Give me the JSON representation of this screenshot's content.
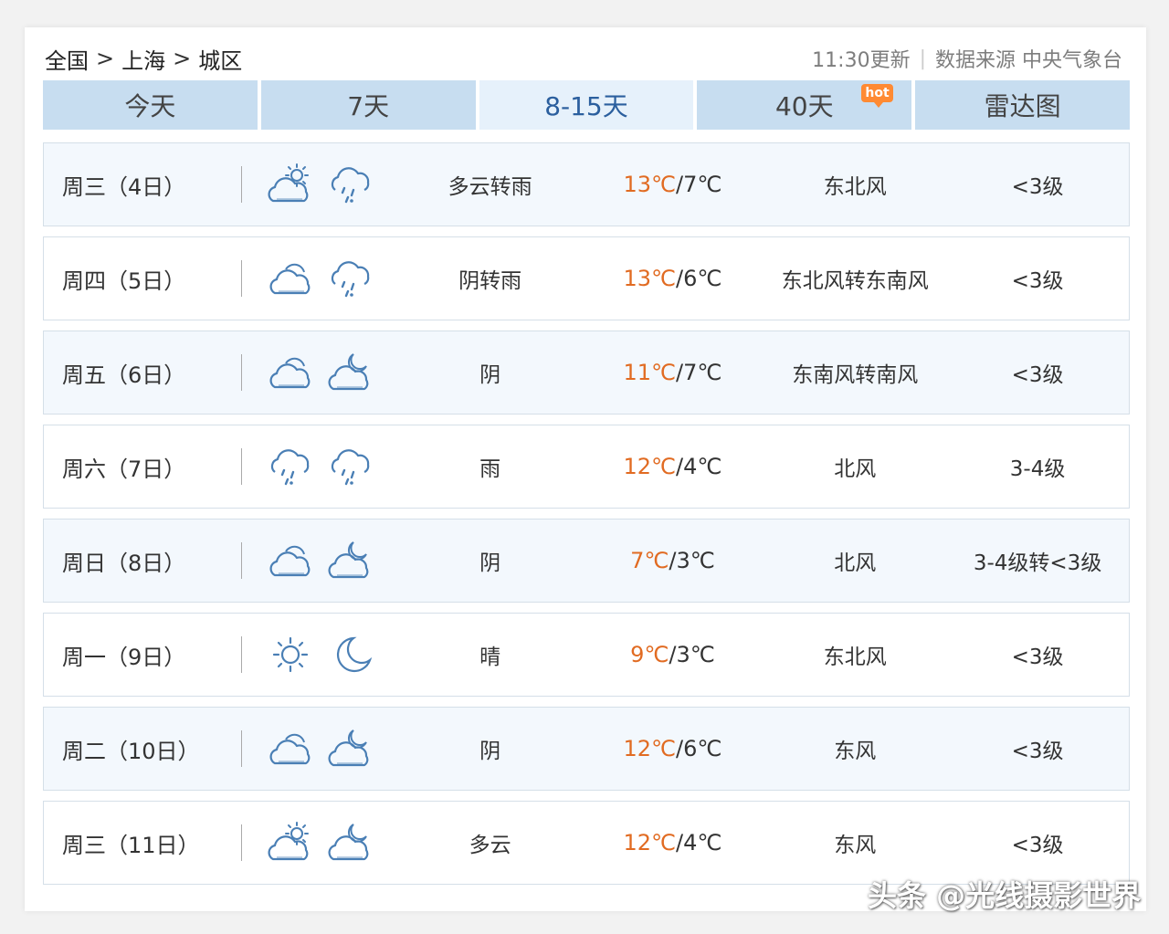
{
  "breadcrumb": {
    "items": [
      "全国",
      "上海",
      "城区"
    ],
    "separator": ">"
  },
  "meta": {
    "updated": "11:30更新",
    "source": "数据来源 中央气象台"
  },
  "tabs": [
    {
      "label": "今天"
    },
    {
      "label": "7天"
    },
    {
      "label": "8-15天",
      "active": true
    },
    {
      "label": "40天",
      "badge": "hot"
    },
    {
      "label": "雷达图"
    }
  ],
  "forecast": [
    {
      "day": "周三（4日）",
      "icons": [
        "partly-cloudy-day-icon",
        "rain-icon"
      ],
      "weather": "多云转雨",
      "high": "13℃",
      "low": "7℃",
      "wind": "东北风",
      "level": "<3级"
    },
    {
      "day": "周四（5日）",
      "icons": [
        "cloudy-icon",
        "rain-icon"
      ],
      "weather": "阴转雨",
      "high": "13℃",
      "low": "6℃",
      "wind": "东北风转东南风",
      "level": "<3级"
    },
    {
      "day": "周五（6日）",
      "icons": [
        "cloudy-icon",
        "partly-cloudy-night-icon"
      ],
      "weather": "阴",
      "high": "11℃",
      "low": "7℃",
      "wind": "东南风转南风",
      "level": "<3级"
    },
    {
      "day": "周六（7日）",
      "icons": [
        "rain-icon",
        "rain-icon"
      ],
      "weather": "雨",
      "high": "12℃",
      "low": "4℃",
      "wind": "北风",
      "level": "3-4级"
    },
    {
      "day": "周日（8日）",
      "icons": [
        "cloudy-icon",
        "partly-cloudy-night-icon"
      ],
      "weather": "阴",
      "high": "7℃",
      "low": "3℃",
      "wind": "北风",
      "level": "3-4级转<3级"
    },
    {
      "day": "周一（9日）",
      "icons": [
        "sun-icon",
        "moon-icon"
      ],
      "weather": "晴",
      "high": "9℃",
      "low": "3℃",
      "wind": "东北风",
      "level": "<3级"
    },
    {
      "day": "周二（10日）",
      "icons": [
        "cloudy-icon",
        "partly-cloudy-night-icon"
      ],
      "weather": "阴",
      "high": "12℃",
      "low": "6℃",
      "wind": "东风",
      "level": "<3级"
    },
    {
      "day": "周三（11日）",
      "icons": [
        "partly-cloudy-day-icon",
        "partly-cloudy-night-icon"
      ],
      "weather": "多云",
      "high": "12℃",
      "low": "4℃",
      "wind": "东风",
      "level": "<3级"
    }
  ],
  "watermark": "头条 @光线摄影世界",
  "colors": {
    "tab": "#c7ddf0",
    "tab_active": "#e6f1fb",
    "accent": "#2b5f9e",
    "high_temp": "#e16b22",
    "row_alt": "#f3f8fd",
    "icon": "#4a7fb5",
    "hot_badge": "#ff8a33"
  }
}
